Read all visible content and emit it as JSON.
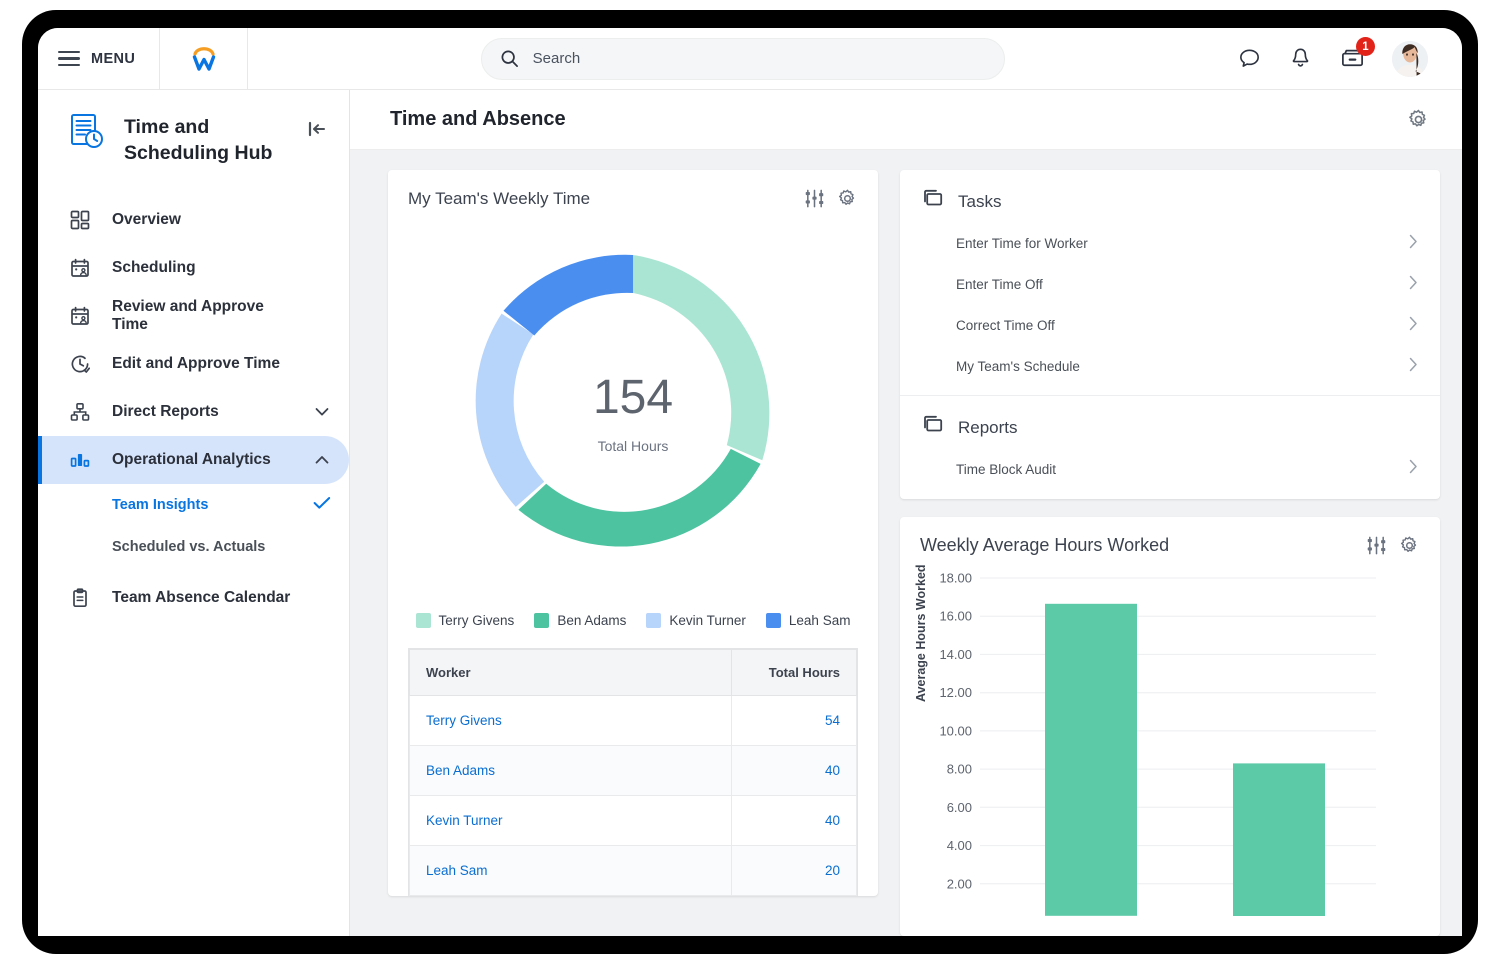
{
  "header": {
    "menu_label": "MENU",
    "logo_name": "workday-logo",
    "search": {
      "placeholder": "Search",
      "value": ""
    },
    "actions": [
      {
        "name": "chat-icon",
        "label": "Chat"
      },
      {
        "name": "notifications-bell-icon",
        "label": "Notifications"
      },
      {
        "name": "inbox-icon",
        "label": "Inbox",
        "badge": "1"
      }
    ],
    "avatar_alt": "User profile photo"
  },
  "sidebar": {
    "hub_title": "Time and Scheduling Hub",
    "hub_icon": "time-scheduling-doc-clock-icon",
    "collapse_icon": "collapse-panel-icon",
    "items": [
      {
        "label": "Overview",
        "icon": "grid-overview-icon",
        "active": false,
        "chevron": ""
      },
      {
        "label": "Scheduling",
        "icon": "calendar-person-icon",
        "active": false,
        "chevron": ""
      },
      {
        "label": "Review and Approve Time",
        "icon": "calendar-person-icon",
        "active": false,
        "chevron": ""
      },
      {
        "label": "Edit and Approve Time",
        "icon": "clock-check-icon",
        "active": false,
        "chevron": "down"
      },
      {
        "label": "Direct Reports",
        "icon": "org-chart-icon",
        "active": false,
        "chevron": "down"
      },
      {
        "label": "Operational Analytics",
        "icon": "bar-chart-icon",
        "active": true,
        "chevron": "up"
      }
    ],
    "sub_items": [
      {
        "label": "Team Insights",
        "selected": true
      },
      {
        "label": "Scheduled vs. Actuals",
        "selected": false
      }
    ],
    "trailing_items": [
      {
        "label": "Team Absence Calendar",
        "icon": "clipboard-icon",
        "active": false,
        "chevron": ""
      }
    ]
  },
  "page": {
    "title": "Time and Absence",
    "settings_icon": "gear-icon"
  },
  "weekly_time_card": {
    "title": "My Team's Weekly Time",
    "tools": [
      "sliders-filter-icon",
      "gear-icon"
    ],
    "center_value": "154",
    "center_caption": "Total Hours",
    "table": {
      "columns": [
        "Worker",
        "Total Hours"
      ],
      "rows": [
        {
          "worker": "Terry Givens",
          "hours": "54"
        },
        {
          "worker": "Ben Adams",
          "hours": "40"
        },
        {
          "worker": "Kevin Turner",
          "hours": "40"
        },
        {
          "worker": "Leah Sam",
          "hours": "20"
        }
      ]
    }
  },
  "tasks_card": {
    "tasks_icon": "stacked-windows-icon",
    "tasks_title": "Tasks",
    "tasks": [
      "Enter Time for Worker",
      "Enter Time Off",
      "Correct Time Off",
      "My Team's Schedule"
    ],
    "reports_icon": "stacked-windows-icon",
    "reports_title": "Reports",
    "reports": [
      "Time Block Audit"
    ],
    "chevron_icon": "chevron-right-icon"
  },
  "bar_card": {
    "title": "Weekly Average Hours Worked",
    "tools": [
      "sliders-filter-icon",
      "gear-icon"
    ]
  },
  "colors": {
    "accent_blue": "#0875e1",
    "link_blue": "#0a6ed1",
    "badge_red": "#e2231a",
    "brand_orange": "#f59e23",
    "teal_bar": "#5cc9a7",
    "sel_bg": "#d6e4fb"
  },
  "chart_data": [
    {
      "type": "pie",
      "variant": "donut",
      "title": "My Team's Weekly Time",
      "center_value": 154,
      "center_label": "Total Hours",
      "unit": "hours",
      "legend_position": "bottom",
      "labels": [
        "Terry Givens",
        "Ben Adams",
        "Kevin Turner",
        "Leah Sam"
      ],
      "values": [
        54,
        40,
        40,
        20
      ],
      "colors": [
        "#a9e5d2",
        "#4dc3a0",
        "#b7d4fb",
        "#4a8ff0"
      ],
      "total": 154,
      "start_angle_deg": 0,
      "direction": "clockwise"
    },
    {
      "type": "bar",
      "title": "Weekly Average Hours Worked",
      "xlabel": "",
      "ylabel": "Average Hours Worked",
      "categories": [
        "",
        ""
      ],
      "values": [
        16.65,
        8.3
      ],
      "ylim": [
        0,
        18
      ],
      "yticks": [
        "2.00",
        "4.00",
        "6.00",
        "8.00",
        "10.00",
        "12.00",
        "14.00",
        "16.00",
        "18.00"
      ],
      "grid": true,
      "bar_color": "#5cc9a7",
      "note": "Chart is clipped by the viewport bottom; x-axis labels not visible"
    }
  ]
}
